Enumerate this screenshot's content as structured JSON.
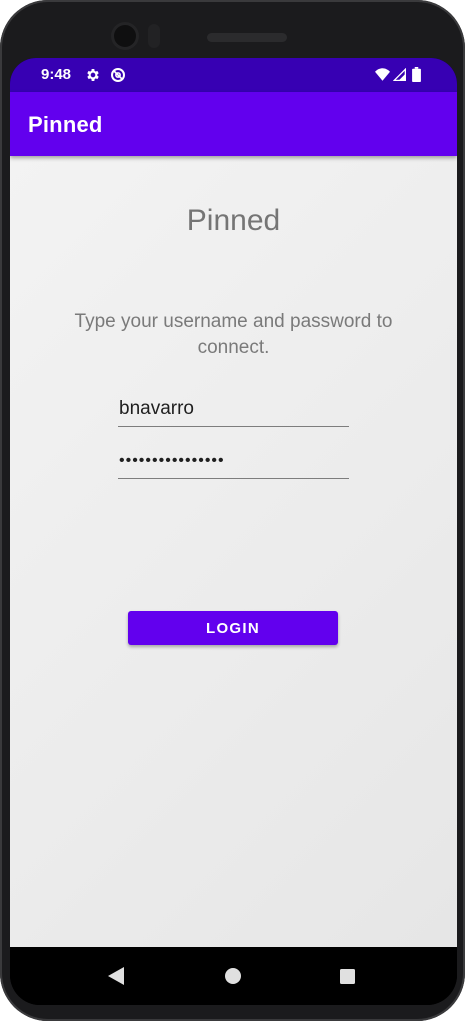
{
  "status_bar": {
    "time": "9:48",
    "icons": [
      "gear-icon",
      "sync-blocked-icon",
      "wifi-icon",
      "cellular-signal-icon",
      "battery-icon"
    ]
  },
  "app_bar": {
    "title": "Pinned"
  },
  "login": {
    "heading": "Pinned",
    "instructions": "Type your username and password to connect.",
    "username_value": "bnavarro",
    "password_value": "••••••••••••••••",
    "button_label": "LOGIN"
  },
  "navigation_bar": {
    "icons": [
      "back-icon",
      "home-icon",
      "recents-icon"
    ]
  },
  "colors": {
    "status_bar": "#3700b3",
    "primary": "#6200ee",
    "background": "#eeeeee",
    "text_secondary": "#757575"
  }
}
